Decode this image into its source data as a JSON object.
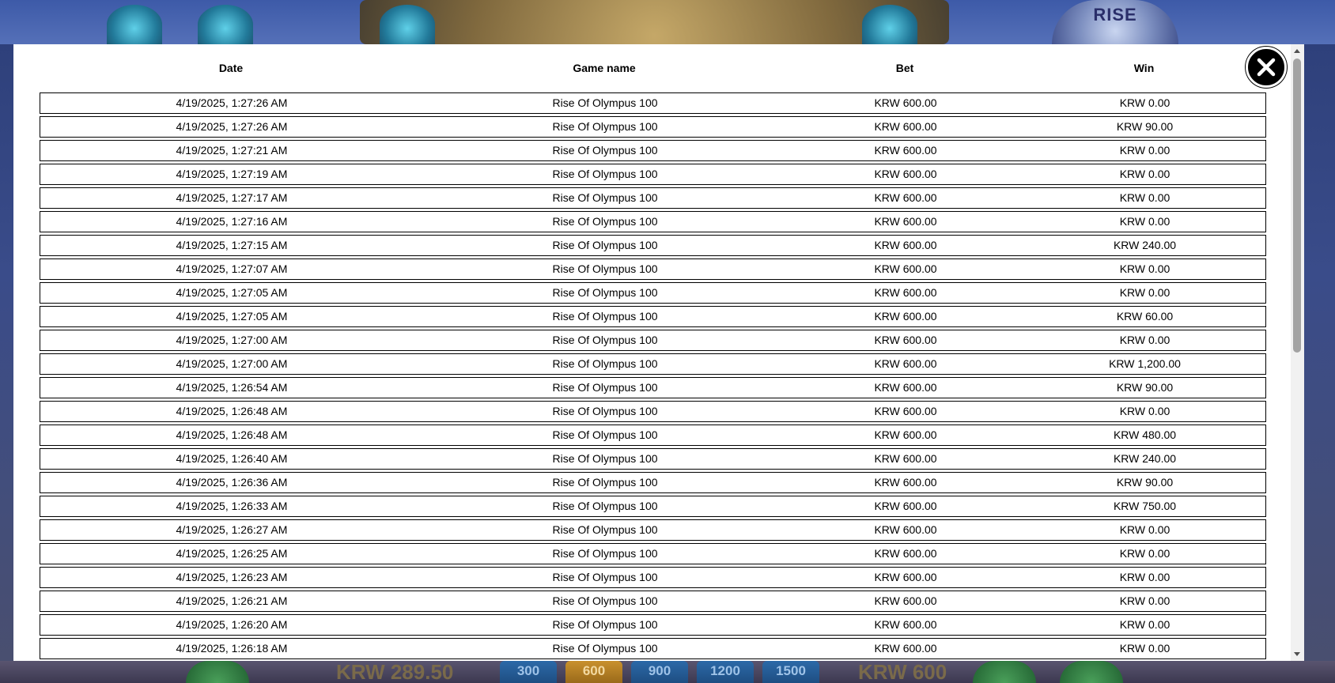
{
  "header": {
    "date": "Date",
    "game_name": "Game name",
    "bet": "Bet",
    "win": "Win"
  },
  "rows": [
    {
      "date": "4/19/2025, 1:27:26 AM",
      "game": "Rise Of Olympus 100",
      "bet": "KRW 600.00",
      "win": "KRW 0.00"
    },
    {
      "date": "4/19/2025, 1:27:26 AM",
      "game": "Rise Of Olympus 100",
      "bet": "KRW 600.00",
      "win": "KRW 90.00"
    },
    {
      "date": "4/19/2025, 1:27:21 AM",
      "game": "Rise Of Olympus 100",
      "bet": "KRW 600.00",
      "win": "KRW 0.00"
    },
    {
      "date": "4/19/2025, 1:27:19 AM",
      "game": "Rise Of Olympus 100",
      "bet": "KRW 600.00",
      "win": "KRW 0.00"
    },
    {
      "date": "4/19/2025, 1:27:17 AM",
      "game": "Rise Of Olympus 100",
      "bet": "KRW 600.00",
      "win": "KRW 0.00"
    },
    {
      "date": "4/19/2025, 1:27:16 AM",
      "game": "Rise Of Olympus 100",
      "bet": "KRW 600.00",
      "win": "KRW 0.00"
    },
    {
      "date": "4/19/2025, 1:27:15 AM",
      "game": "Rise Of Olympus 100",
      "bet": "KRW 600.00",
      "win": "KRW 240.00"
    },
    {
      "date": "4/19/2025, 1:27:07 AM",
      "game": "Rise Of Olympus 100",
      "bet": "KRW 600.00",
      "win": "KRW 0.00"
    },
    {
      "date": "4/19/2025, 1:27:05 AM",
      "game": "Rise Of Olympus 100",
      "bet": "KRW 600.00",
      "win": "KRW 0.00"
    },
    {
      "date": "4/19/2025, 1:27:05 AM",
      "game": "Rise Of Olympus 100",
      "bet": "KRW 600.00",
      "win": "KRW 60.00"
    },
    {
      "date": "4/19/2025, 1:27:00 AM",
      "game": "Rise Of Olympus 100",
      "bet": "KRW 600.00",
      "win": "KRW 0.00"
    },
    {
      "date": "4/19/2025, 1:27:00 AM",
      "game": "Rise Of Olympus 100",
      "bet": "KRW 600.00",
      "win": "KRW 1,200.00"
    },
    {
      "date": "4/19/2025, 1:26:54 AM",
      "game": "Rise Of Olympus 100",
      "bet": "KRW 600.00",
      "win": "KRW 90.00"
    },
    {
      "date": "4/19/2025, 1:26:48 AM",
      "game": "Rise Of Olympus 100",
      "bet": "KRW 600.00",
      "win": "KRW 0.00"
    },
    {
      "date": "4/19/2025, 1:26:48 AM",
      "game": "Rise Of Olympus 100",
      "bet": "KRW 600.00",
      "win": "KRW 480.00"
    },
    {
      "date": "4/19/2025, 1:26:40 AM",
      "game": "Rise Of Olympus 100",
      "bet": "KRW 600.00",
      "win": "KRW 240.00"
    },
    {
      "date": "4/19/2025, 1:26:36 AM",
      "game": "Rise Of Olympus 100",
      "bet": "KRW 600.00",
      "win": "KRW 90.00"
    },
    {
      "date": "4/19/2025, 1:26:33 AM",
      "game": "Rise Of Olympus 100",
      "bet": "KRW 600.00",
      "win": "KRW 750.00"
    },
    {
      "date": "4/19/2025, 1:26:27 AM",
      "game": "Rise Of Olympus 100",
      "bet": "KRW 600.00",
      "win": "KRW 0.00"
    },
    {
      "date": "4/19/2025, 1:26:25 AM",
      "game": "Rise Of Olympus 100",
      "bet": "KRW 600.00",
      "win": "KRW 0.00"
    },
    {
      "date": "4/19/2025, 1:26:23 AM",
      "game": "Rise Of Olympus 100",
      "bet": "KRW 600.00",
      "win": "KRW 0.00"
    },
    {
      "date": "4/19/2025, 1:26:21 AM",
      "game": "Rise Of Olympus 100",
      "bet": "KRW 600.00",
      "win": "KRW 0.00"
    },
    {
      "date": "4/19/2025, 1:26:20 AM",
      "game": "Rise Of Olympus 100",
      "bet": "KRW 600.00",
      "win": "KRW 0.00"
    },
    {
      "date": "4/19/2025, 1:26:18 AM",
      "game": "Rise Of Olympus 100",
      "bet": "KRW 600.00",
      "win": "KRW 0.00"
    }
  ],
  "background": {
    "logo_text": "RISE",
    "balance": "KRW 289.50",
    "current_bet": "KRW 600",
    "bet_options": [
      "300",
      "600",
      "900",
      "1200",
      "1500"
    ]
  },
  "icons": {
    "close": "close-icon",
    "scroll_up": "chevron-up-icon",
    "scroll_down": "chevron-down-icon"
  },
  "colors": {
    "modal_bg": "#ffffff",
    "text": "#000000",
    "row_border": "#000000",
    "close_bg": "#000000"
  }
}
